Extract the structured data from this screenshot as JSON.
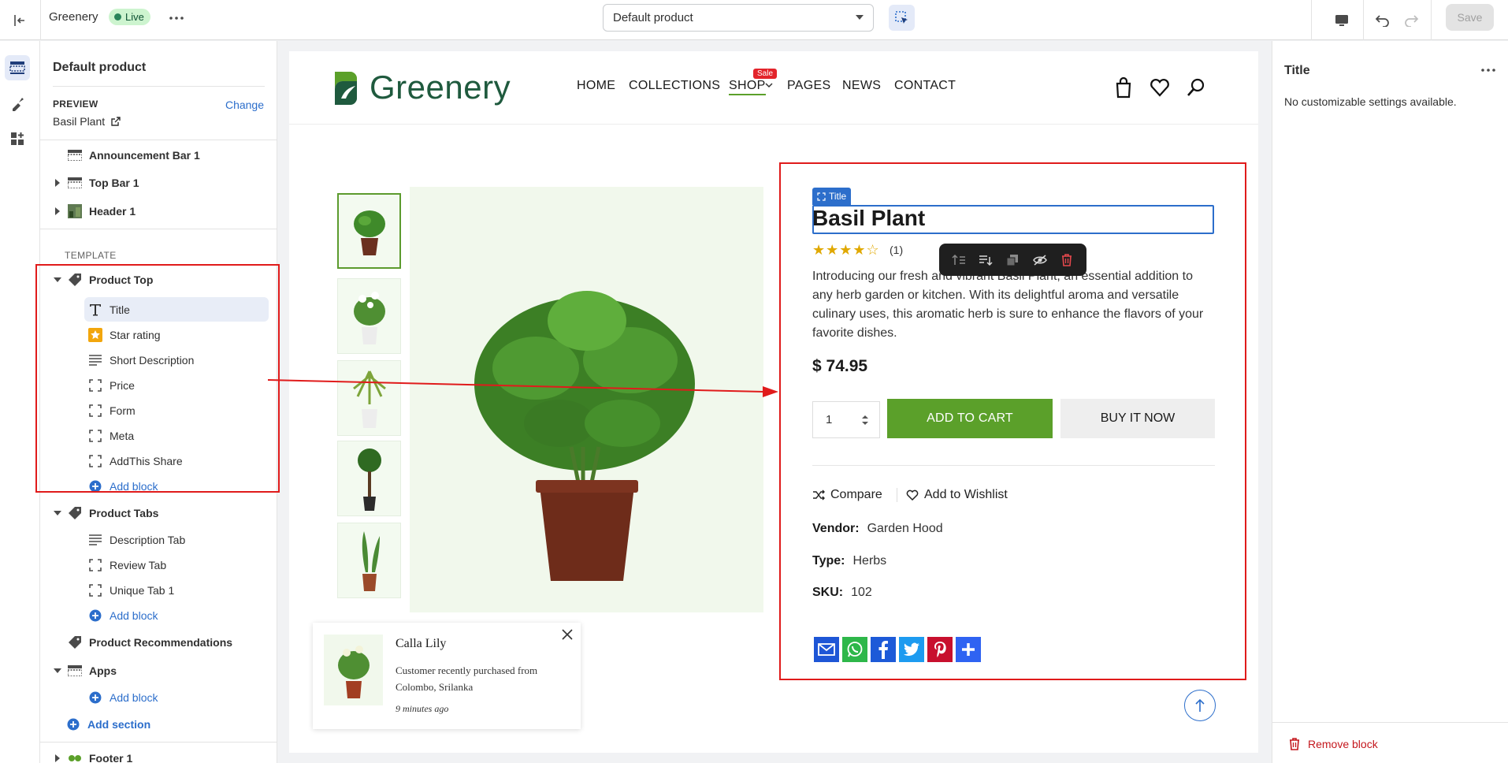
{
  "topbar": {
    "store_name": "Greenery",
    "status": "Live",
    "template_select": "Default product",
    "save_label": "Save"
  },
  "sidebar": {
    "title": "Default product",
    "preview_label": "PREVIEW",
    "change_label": "Change",
    "preview_item": "Basil Plant",
    "header_sections": [
      "Announcement Bar 1",
      "Top Bar 1",
      "Header 1"
    ],
    "template_label": "TEMPLATE",
    "product_top": {
      "label": "Product Top",
      "blocks": [
        "Title",
        "Star rating",
        "Short Description",
        "Price",
        "Form",
        "Meta",
        "AddThis Share"
      ],
      "add_block": "Add block"
    },
    "product_tabs": {
      "label": "Product Tabs",
      "blocks": [
        "Description Tab",
        "Review Tab",
        "Unique Tab 1"
      ],
      "add_block": "Add block"
    },
    "product_recommendations": "Product Recommendations",
    "apps": {
      "label": "Apps",
      "add_block": "Add block"
    },
    "add_section": "Add section",
    "footer": "Footer 1"
  },
  "store": {
    "logo_text": "Greenery",
    "nav": [
      "HOME",
      "COLLECTIONS",
      "SHOP",
      "PAGES",
      "NEWS",
      "CONTACT"
    ],
    "sale_badge": "Sale"
  },
  "product": {
    "block_tag": "Title",
    "title": "Basil Plant",
    "rating_stars": "★★★★☆",
    "rating": 4,
    "review_count": "(1)",
    "description": "Introducing our fresh and vibrant Basil Plant, an essential addition to any herb garden or kitchen. With its delightful aroma and versatile culinary uses, this aromatic herb is sure to enhance the flavors of your favorite dishes.",
    "price": "$ 74.95",
    "quantity": "1",
    "add_to_cart": "ADD TO CART",
    "buy_now": "BUY IT NOW",
    "compare": "Compare",
    "wishlist": "Add to Wishlist",
    "vendor_label": "Vendor:",
    "vendor": "Garden Hood",
    "type_label": "Type:",
    "type": "Herbs",
    "sku_label": "SKU:",
    "sku": "102",
    "share_icons": [
      "email-icon",
      "whatsapp-icon",
      "facebook-icon",
      "twitter-icon",
      "pinterest-icon",
      "addthis-plus-icon"
    ]
  },
  "popup": {
    "name": "Calla Lily",
    "text": "Customer recently purchased  from Colombo, Srilanka",
    "time": "9 minutes ago"
  },
  "right_panel": {
    "title": "Title",
    "message": "No customizable settings available.",
    "remove_label": "Remove block"
  },
  "colors": {
    "accent": "#2c6ecb",
    "cart_button": "#5ba02a",
    "highlight_box": "#e01b1b",
    "live_badge": "#cdf4cf",
    "remove": "#c4171d"
  }
}
